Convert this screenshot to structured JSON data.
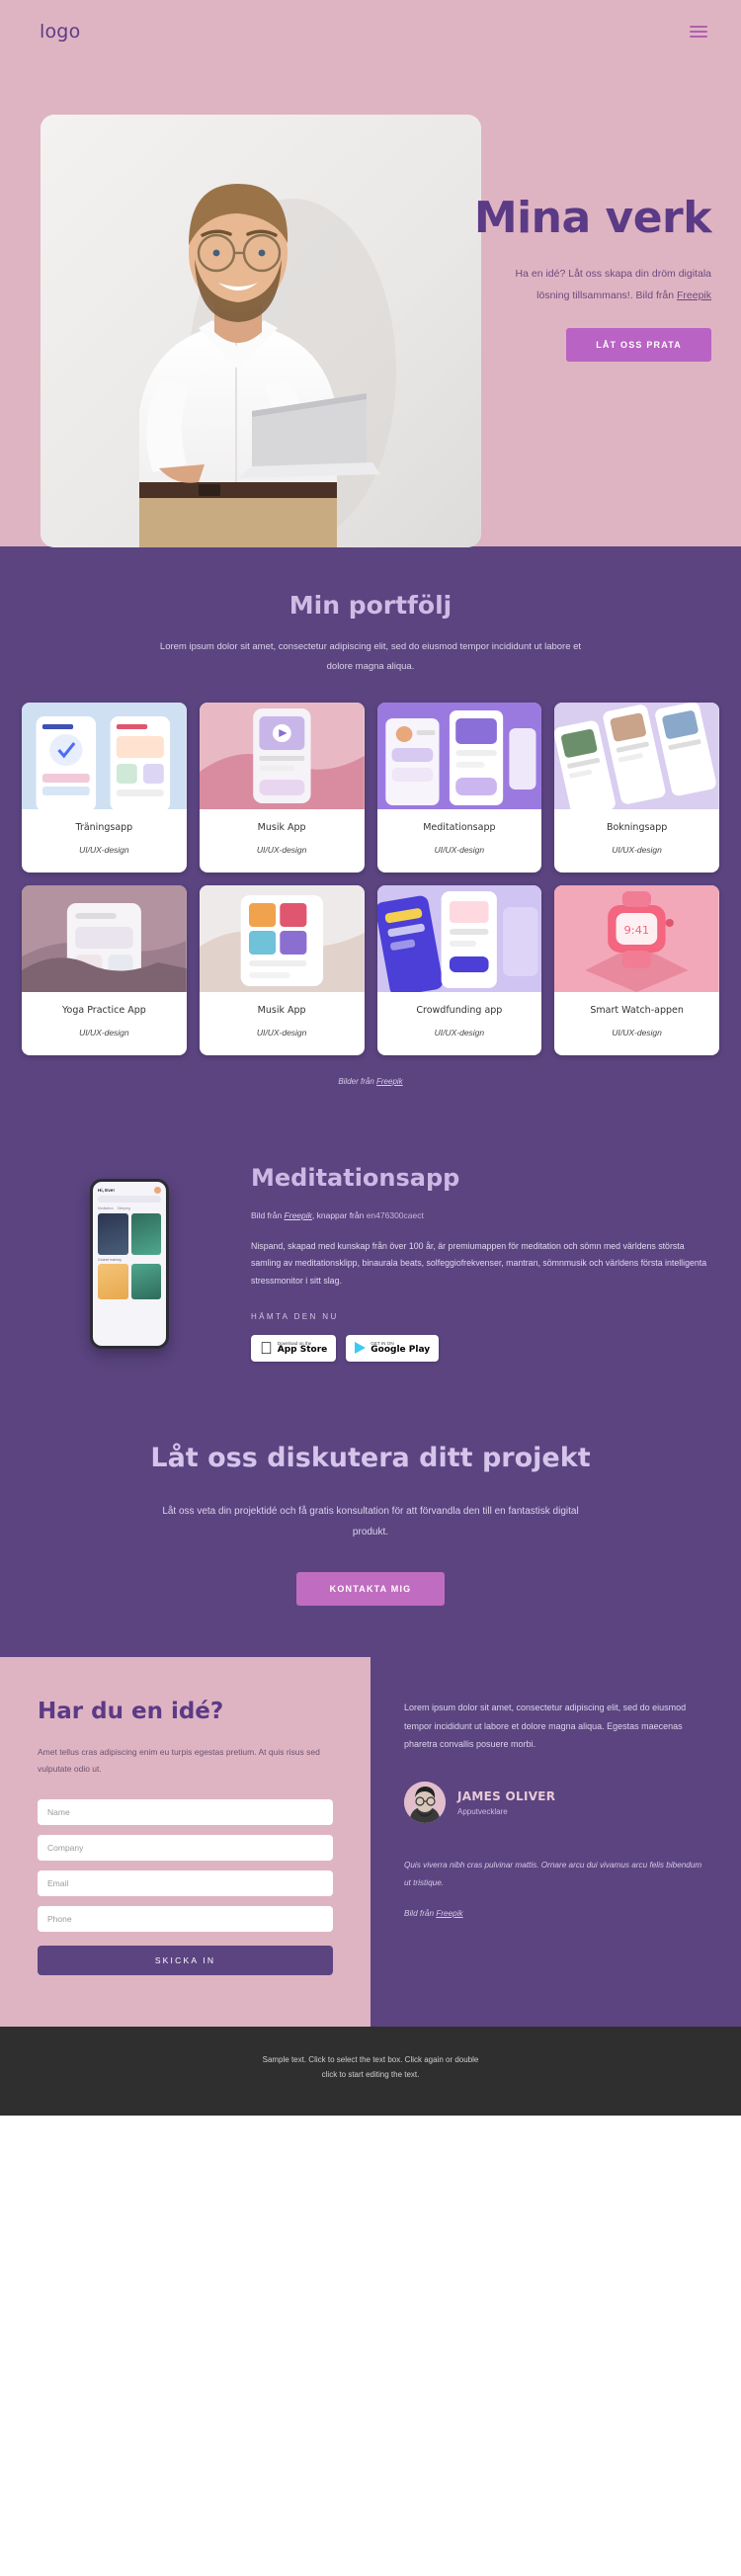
{
  "header": {
    "logo": "logo",
    "menu_icon": "hamburger-menu-icon"
  },
  "hero": {
    "title": "Mina verk",
    "subtitle_line1": "Ha en idé? Låt oss skapa din dröm digitala",
    "subtitle_line2_pre": "lösning tillsammans!. Bild från ",
    "subtitle_link": "Freepik",
    "cta": "LÅT OSS PRATA",
    "bg_color": "#dfb4c2",
    "title_color": "#5b3a86",
    "cta_color": "#b963c4",
    "image_alt": "smiling-man-with-laptop-photo"
  },
  "portfolio": {
    "title": "Min portfölj",
    "subtitle": "Lorem ipsum dolor sit amet, consectetur adipiscing elit, sed do eiusmod tempor incididunt ut labore et dolore magna aliqua.",
    "bg_color": "#5b4480",
    "title_color": "#cfbbe4",
    "credit_pre": "Bilder från ",
    "credit_link": "Freepik",
    "cards": [
      {
        "title": "Träningsapp",
        "tag": "UI/UX-design",
        "img": "fitness-app-screens"
      },
      {
        "title": "Musik App",
        "tag": "UI/UX-design",
        "img": "music-app-hand-phone"
      },
      {
        "title": "Meditationsapp",
        "tag": "UI/UX-design",
        "img": "meditation-app-purple"
      },
      {
        "title": "Bokningsapp",
        "tag": "UI/UX-design",
        "img": "booking-app-cards"
      },
      {
        "title": "Yoga Practice App",
        "tag": "UI/UX-design",
        "img": "yoga-app-hands-mat"
      },
      {
        "title": "Musik App",
        "tag": "UI/UX-design",
        "img": "music-app-grid-phone"
      },
      {
        "title": "Crowdfunding app",
        "tag": "UI/UX-design",
        "img": "crowdfunding-phones"
      },
      {
        "title": "Smart Watch-appen",
        "tag": "UI/UX-design",
        "img": "smartwatch-pink-3d"
      }
    ]
  },
  "meditation": {
    "title": "Meditationsapp",
    "credit_pre": "Bild från ",
    "credit_link": "Freepik",
    "credit_mid": ", knappar från ",
    "credit_code": "en476300caect",
    "body": "Nispand, skapad med kunskap från över 100 år, är premiumappen för meditation och sömn med världens största samling av meditationsklipp, binaurala beats, solfeggiofrekvenser, mantran, sömnmusik och världens första intelligenta stressmonitor i sitt slag.",
    "download_label": "HÄMTA DEN NU",
    "stores": [
      {
        "small": "Download on the",
        "big": "App Store",
        "icon": "apple-icon"
      },
      {
        "small": "GET IN ON",
        "big": "Google Play",
        "icon": "google-play-icon"
      }
    ],
    "phone": {
      "greeting": "Hi, Eve!",
      "search_placeholder": "Search meditation",
      "tabs": [
        "Meditation",
        "Sleeping"
      ],
      "section1": "Mountain stream",
      "section2": "Quiet forest",
      "section3": "Colored morning"
    }
  },
  "discuss": {
    "title": "Låt oss diskutera ditt projekt",
    "body": "Låt oss veta din projektidé och få gratis konsultation för att förvandla den till en fantastisk digital produkt.",
    "cta": "KONTAKTA MIG"
  },
  "contact": {
    "title": "Har du en idé?",
    "body": "Amet tellus cras adipiscing enim eu turpis egestas pretium. At quis risus sed vulputate odio ut.",
    "fields": [
      {
        "name": "name-field",
        "placeholder": "Name",
        "value": ""
      },
      {
        "name": "company-field",
        "placeholder": "Company",
        "value": ""
      },
      {
        "name": "email-field",
        "placeholder": "Email",
        "value": ""
      },
      {
        "name": "phone-field",
        "placeholder": "Phone",
        "value": ""
      }
    ],
    "submit": "SKICKA IN"
  },
  "testimonial": {
    "quote": "Lorem ipsum dolor sit amet, consectetur adipiscing elit, sed do eiusmod tempor incididunt ut labore et dolore magna aliqua. Egestas maecenas pharetra convallis posuere morbi.",
    "name": "JAMES OLIVER",
    "role": "Apputvecklare",
    "quote2": "Quis viverra nibh cras pulvinar mattis. Ornare arcu dui vivamus arcu felis bibendum ut tristique.",
    "credit_pre": "Bild från ",
    "credit_link": "Freepik",
    "avatar_alt": "james-oliver-avatar"
  },
  "footer": {
    "line1": "Sample text. Click to select the text box. Click again or double",
    "line2": "click to start editing the text.",
    "bg_color": "#302f30"
  }
}
